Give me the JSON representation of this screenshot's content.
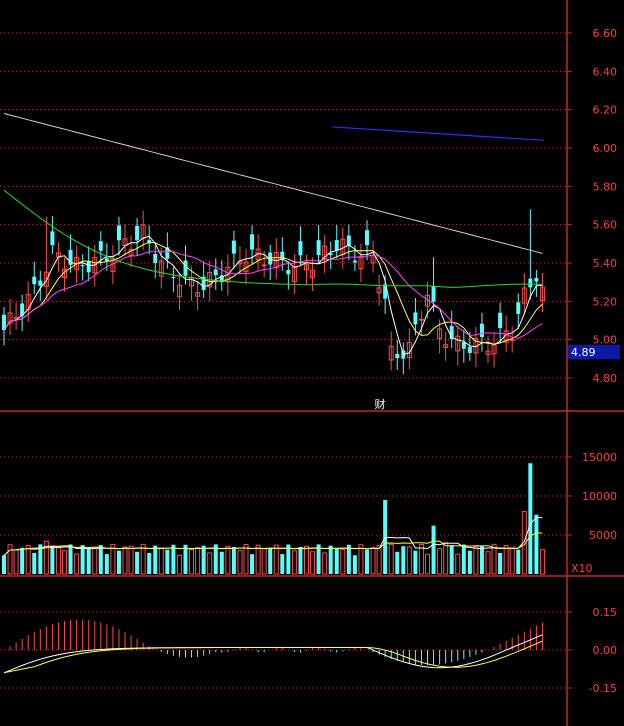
{
  "colors": {
    "background": "#000000",
    "frame": "#c8262a",
    "grid": "#c8262a",
    "up_candle": "#ff4a4a",
    "down_candle": "#54ffff",
    "axis_text": "#ff3b3b",
    "ma_short": "#ffffff",
    "ma_mid": "#ffff55",
    "ma_long1": "#ff40ff",
    "ma_long2": "#22dd22",
    "ma_long3": "#d8d0c0",
    "trend_line": "#2233ff",
    "price_tag_bg": "#0b18a8",
    "price_tag_text": "#ffffff",
    "financial_marker": "#ffffff"
  },
  "chart_data": [
    {
      "type": "candlestick",
      "panel": "price",
      "ylim": [
        4.7,
        6.72
      ],
      "y_ticks": [
        "6.60",
        "6.40",
        "6.20",
        "6.00",
        "5.80",
        "5.60",
        "5.40",
        "5.20",
        "5.00",
        "4.80"
      ],
      "y_tick_values": [
        6.6,
        6.4,
        6.2,
        6.0,
        5.8,
        5.6,
        5.4,
        5.2,
        5.0,
        4.8
      ],
      "current_price_label": "4.89",
      "current_price": 4.89,
      "event_marker": "财",
      "trend_line": {
        "from": [
          6.11
        ],
        "to": [
          6.04
        ]
      },
      "series_summary": {
        "ma_short_color": "white",
        "ma_mid_color": "yellow",
        "ma_long1_color": "magenta",
        "ma_long2_color": "green",
        "ma_long3_color": "beige"
      }
    },
    {
      "type": "bar",
      "panel": "volume",
      "ylim": [
        0,
        19000
      ],
      "y_ticks": [
        "15000",
        "10000",
        "5000"
      ],
      "y_tick_values": [
        15000,
        10000,
        5000
      ],
      "unit_label": "X10"
    },
    {
      "type": "bar",
      "panel": "macd",
      "ylim": [
        -0.2,
        0.2
      ],
      "y_ticks": [
        "0.15",
        "0.00",
        "-0.15"
      ],
      "y_tick_values": [
        0.15,
        0.0,
        -0.15
      ]
    }
  ]
}
